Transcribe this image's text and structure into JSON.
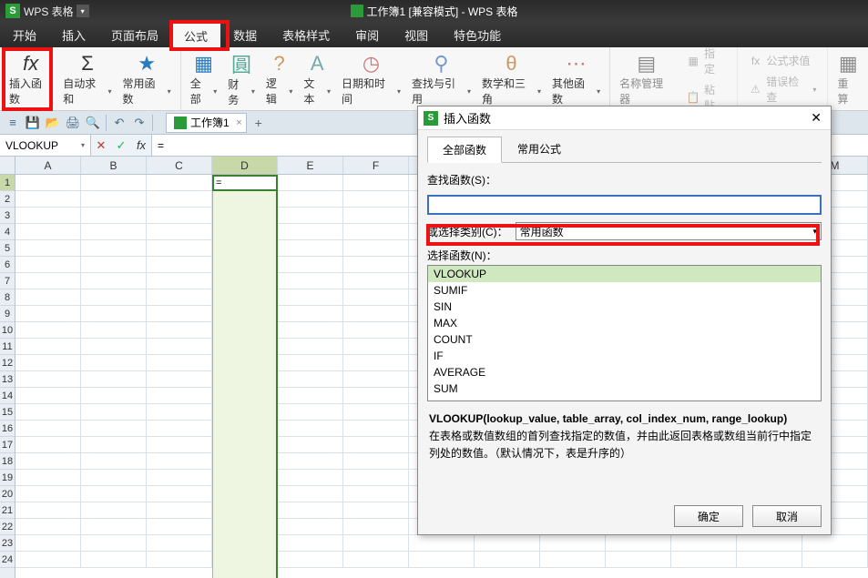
{
  "title": {
    "app": "WPS 表格",
    "doc": "工作簿1 [兼容模式] - WPS 表格"
  },
  "menu": [
    "开始",
    "插入",
    "页面布局",
    "公式",
    "数据",
    "表格样式",
    "审阅",
    "视图",
    "特色功能"
  ],
  "menu_active_index": 3,
  "ribbon": {
    "insert_fn": "插入函数",
    "autosum": "自动求和",
    "common_fn": "常用函数",
    "all": "全部",
    "finance": "财务",
    "logic": "逻辑",
    "text": "文本",
    "datetime": "日期和时间",
    "lookup": "查找与引用",
    "math": "数学和三角",
    "other_fn": "其他函数",
    "fx_symbol": "fx",
    "sigma_symbol": "Σ"
  },
  "ribbon_right": {
    "name_mgr": "名称管理器",
    "paste": "粘贴",
    "assign": "指定",
    "formula_eval": "公式求值",
    "error_check": "错误检查",
    "recalc": "重算"
  },
  "qat": {
    "workbook_tab": "工作簿1"
  },
  "formula_bar": {
    "name_box": "VLOOKUP",
    "value": "="
  },
  "grid": {
    "cols": [
      "A",
      "B",
      "C",
      "D",
      "E",
      "F",
      "",
      "",
      "",
      "",
      "",
      "",
      "M"
    ],
    "active_col_index": 3,
    "row_count": 24,
    "active_row": 1,
    "active_cell_value": "="
  },
  "dialog": {
    "title": "插入函数",
    "tabs": [
      "全部函数",
      "常用公式"
    ],
    "active_tab": 0,
    "search_label": "查找函数(S)：",
    "category_label": "或选择类别(C)：",
    "category_value": "常用函数",
    "select_fn_label": "选择函数(N)：",
    "functions": [
      "VLOOKUP",
      "SUMIF",
      "SIN",
      "MAX",
      "COUNT",
      "IF",
      "AVERAGE",
      "SUM"
    ],
    "selected_fn_index": 0,
    "signature": "VLOOKUP(lookup_value, table_array, col_index_num, range_lookup)",
    "description": "在表格或数值数组的首列查找指定的数值，并由此返回表格或数组当前行中指定列处的数值。（默认情况下，表是升序的）",
    "ok": "确定",
    "cancel": "取消"
  }
}
